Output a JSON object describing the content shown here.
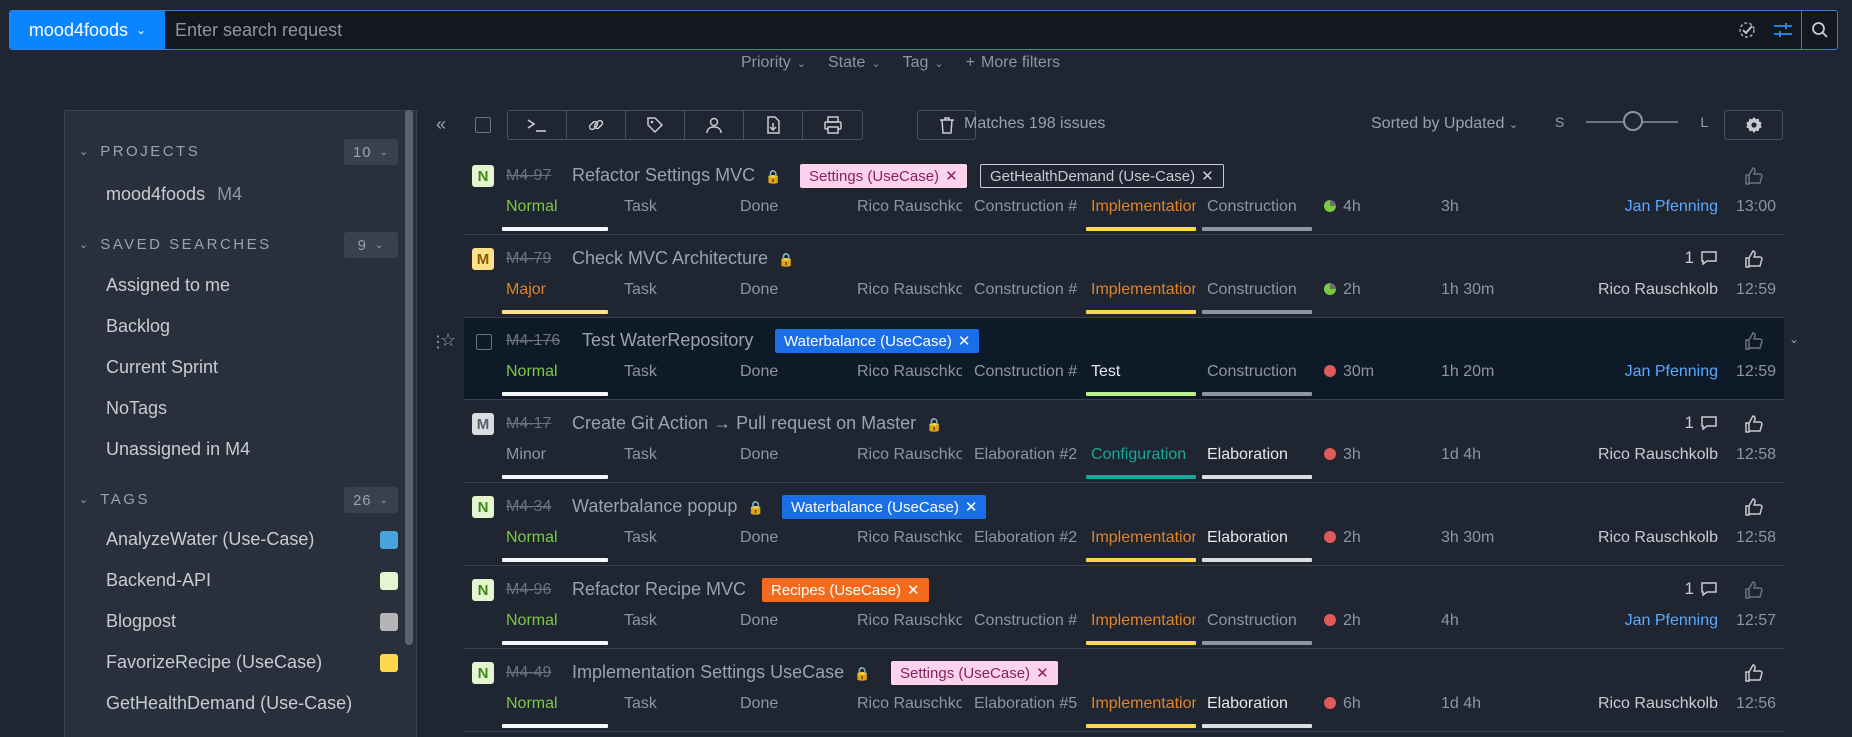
{
  "topbar": {
    "project": "mood4foods",
    "placeholder": "Enter search request"
  },
  "filters": {
    "priority": "Priority",
    "state": "State",
    "tag": "Tag",
    "more": "More filters"
  },
  "sidebar": {
    "projects": {
      "label": "PROJECTS",
      "count": "10"
    },
    "project_item": {
      "name": "mood4foods",
      "key": "M4"
    },
    "saved": {
      "label": "SAVED SEARCHES",
      "count": "9"
    },
    "saved_items": [
      "Assigned to me",
      "Backlog",
      "Current Sprint",
      "NoTags",
      "Unassigned in M4"
    ],
    "tags": {
      "label": "TAGS",
      "count": "26"
    },
    "tag_items": [
      {
        "label": "AnalyzeWater (Use-Case)",
        "color": "#4aa3df"
      },
      {
        "label": "Backend-API",
        "color": "#e6f5d0"
      },
      {
        "label": "Blogpost",
        "color": "#b5b5b5"
      },
      {
        "label": "FavorizeRecipe (UseCase)",
        "color": "#ffd84d"
      },
      {
        "label": "GetHealthDemand (Use-Case)",
        "color": ""
      }
    ]
  },
  "toolbar": {
    "matches": "Matches 198 issues",
    "sorted": "Sorted by Updated",
    "size_s": "S",
    "size_l": "L"
  },
  "issues": [
    {
      "prio": "N",
      "id": "M4-97",
      "title": "Refactor Settings MVC",
      "tags": [
        {
          "label": "Settings (UseCase)",
          "style": "pink"
        },
        {
          "label": "GetHealthDemand (Use-Case)",
          "style": "outline"
        }
      ],
      "priority": "Normal",
      "type": "Task",
      "state": "Done",
      "assignee": "Rico Rauschkolb",
      "sprint": "Construction #",
      "subsystem": "Implementation",
      "phase": "Construction",
      "estimate": "4h",
      "spent": "3h",
      "updater": "Jan Pfenning",
      "time": "13:00",
      "comments": ""
    },
    {
      "prio": "M",
      "id": "M4-79",
      "title": "Check MVC Architecture",
      "tags": [],
      "priority": "Major",
      "type": "Task",
      "state": "Done",
      "assignee": "Rico Rauschkolb",
      "sprint": "Construction #",
      "subsystem": "Implementation",
      "phase": "Construction",
      "estimate": "2h",
      "spent": "1h 30m",
      "updater": "Rico Rauschkolb",
      "time": "12:59",
      "comments": "1"
    },
    {
      "prio": "N",
      "id": "M4-176",
      "title": "Test WaterRepository",
      "tags": [
        {
          "label": "Waterbalance (UseCase)",
          "style": "blue"
        }
      ],
      "priority": "Normal",
      "type": "Task",
      "state": "Done",
      "assignee": "Rico Rauschkolb",
      "sprint": "Construction #",
      "subsystem": "Test",
      "phase": "Construction",
      "estimate": "30m",
      "spent": "1h 20m",
      "updater": "Jan Pfenning",
      "time": "12:59",
      "comments": ""
    },
    {
      "prio": "M",
      "id": "M4-17",
      "title": "Create Git Action → Pull request on Master",
      "tags": [],
      "priority": "Minor",
      "type": "Task",
      "state": "Done",
      "assignee": "Rico Rauschkolb",
      "sprint": "Elaboration #2",
      "subsystem": "Configuration",
      "phase": "Elaboration",
      "estimate": "3h",
      "spent": "1d 4h",
      "updater": "Rico Rauschkolb",
      "time": "12:58",
      "comments": "1"
    },
    {
      "prio": "N",
      "id": "M4-34",
      "title": "Waterbalance popup",
      "tags": [
        {
          "label": "Waterbalance (UseCase)",
          "style": "blue"
        }
      ],
      "priority": "Normal",
      "type": "Task",
      "state": "Done",
      "assignee": "Rico Rauschkolb",
      "sprint": "Elaboration #2",
      "subsystem": "Implementation",
      "phase": "Elaboration",
      "estimate": "2h",
      "spent": "3h 30m",
      "updater": "Rico Rauschkolb",
      "time": "12:58",
      "comments": ""
    },
    {
      "prio": "N",
      "id": "M4-96",
      "title": "Refactor Recipe MVC",
      "tags": [
        {
          "label": "Recipes (UseCase)",
          "style": "orange"
        }
      ],
      "priority": "Normal",
      "type": "Task",
      "state": "Done",
      "assignee": "Rico Rauschkolb",
      "sprint": "Construction #",
      "subsystem": "Implementation",
      "phase": "Construction",
      "estimate": "2h",
      "spent": "4h",
      "updater": "Jan Pfenning",
      "time": "12:57",
      "comments": "1"
    },
    {
      "prio": "N",
      "id": "M4-49",
      "title": "Implementation Settings UseCase",
      "tags": [
        {
          "label": "Settings (UseCase)",
          "style": "pink"
        }
      ],
      "priority": "Normal",
      "type": "Task",
      "state": "Done",
      "assignee": "Rico Rauschkolb",
      "sprint": "Elaboration #5",
      "subsystem": "Implementation",
      "phase": "Elaboration",
      "estimate": "6h",
      "spent": "1d 4h",
      "updater": "Rico Rauschkolb",
      "time": "12:56",
      "comments": ""
    }
  ],
  "colors": {
    "accent": "#0a84ff",
    "normal": "#7ac943",
    "major": "#f0a030",
    "minor": "#8e95a1"
  }
}
